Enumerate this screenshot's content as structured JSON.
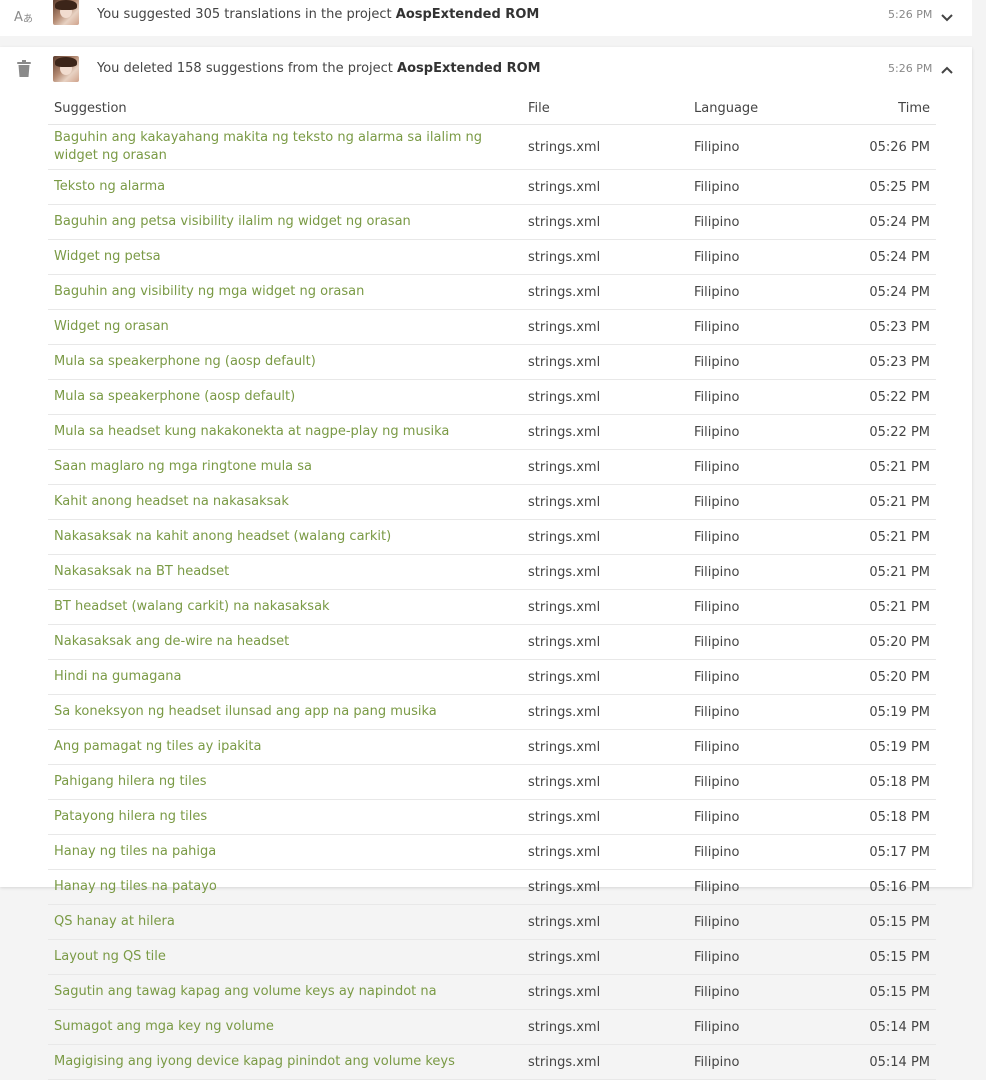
{
  "activities": [
    {
      "icon": "translate-icon",
      "text_prefix": "You suggested 305 translations in the project ",
      "project": "AospExtended ROM",
      "time": "5:26 PM"
    },
    {
      "icon": "trash-icon",
      "text_prefix": "You deleted 158 suggestions from the project ",
      "project": "AospExtended ROM",
      "time": "5:26 PM"
    }
  ],
  "table": {
    "headers": {
      "suggestion": "Suggestion",
      "file": "File",
      "language": "Language",
      "time": "Time"
    },
    "rows": [
      {
        "suggestion": "Baguhin ang kakayahang makita ng teksto ng alarma sa ilalim ng widget ng orasan",
        "file": "strings.xml",
        "language": "Filipino",
        "time": "05:26 PM"
      },
      {
        "suggestion": "Teksto ng alarma",
        "file": "strings.xml",
        "language": "Filipino",
        "time": "05:25 PM"
      },
      {
        "suggestion": "Baguhin ang petsa visibility ilalim ng widget ng orasan",
        "file": "strings.xml",
        "language": "Filipino",
        "time": "05:24 PM"
      },
      {
        "suggestion": "Widget ng petsa",
        "file": "strings.xml",
        "language": "Filipino",
        "time": "05:24 PM"
      },
      {
        "suggestion": "Baguhin ang visibility ng mga widget ng orasan",
        "file": "strings.xml",
        "language": "Filipino",
        "time": "05:24 PM"
      },
      {
        "suggestion": "Widget ng orasan",
        "file": "strings.xml",
        "language": "Filipino",
        "time": "05:23 PM"
      },
      {
        "suggestion": "Mula sa speakerphone ng (aosp default)",
        "file": "strings.xml",
        "language": "Filipino",
        "time": "05:23 PM"
      },
      {
        "suggestion": "Mula sa speakerphone (aosp default)",
        "file": "strings.xml",
        "language": "Filipino",
        "time": "05:22 PM"
      },
      {
        "suggestion": "Mula sa headset kung nakakonekta at nagpe-play ng musika",
        "file": "strings.xml",
        "language": "Filipino",
        "time": "05:22 PM"
      },
      {
        "suggestion": "Saan maglaro ng mga ringtone mula sa",
        "file": "strings.xml",
        "language": "Filipino",
        "time": "05:21 PM"
      },
      {
        "suggestion": "Kahit anong headset na nakasaksak",
        "file": "strings.xml",
        "language": "Filipino",
        "time": "05:21 PM"
      },
      {
        "suggestion": "Nakasaksak na kahit anong headset (walang carkit)",
        "file": "strings.xml",
        "language": "Filipino",
        "time": "05:21 PM"
      },
      {
        "suggestion": "Nakasaksak na BT headset",
        "file": "strings.xml",
        "language": "Filipino",
        "time": "05:21 PM"
      },
      {
        "suggestion": "BT headset (walang carkit) na nakasaksak",
        "file": "strings.xml",
        "language": "Filipino",
        "time": "05:21 PM"
      },
      {
        "suggestion": "Nakasaksak ang de-wire na headset",
        "file": "strings.xml",
        "language": "Filipino",
        "time": "05:20 PM"
      },
      {
        "suggestion": "Hindi na gumagana",
        "file": "strings.xml",
        "language": "Filipino",
        "time": "05:20 PM"
      },
      {
        "suggestion": "Sa koneksyon ng headset ilunsad ang app na pang musika",
        "file": "strings.xml",
        "language": "Filipino",
        "time": "05:19 PM"
      },
      {
        "suggestion": "Ang pamagat ng tiles ay ipakita",
        "file": "strings.xml",
        "language": "Filipino",
        "time": "05:19 PM"
      },
      {
        "suggestion": "Pahigang hilera ng tiles",
        "file": "strings.xml",
        "language": "Filipino",
        "time": "05:18 PM"
      },
      {
        "suggestion": "Patayong hilera ng tiles",
        "file": "strings.xml",
        "language": "Filipino",
        "time": "05:18 PM"
      },
      {
        "suggestion": "Hanay ng tiles na pahiga",
        "file": "strings.xml",
        "language": "Filipino",
        "time": "05:17 PM"
      },
      {
        "suggestion": "Hanay ng tiles na patayo",
        "file": "strings.xml",
        "language": "Filipino",
        "time": "05:16 PM"
      },
      {
        "suggestion": "QS hanay at hilera",
        "file": "strings.xml",
        "language": "Filipino",
        "time": "05:15 PM"
      },
      {
        "suggestion": "Layout ng QS tile",
        "file": "strings.xml",
        "language": "Filipino",
        "time": "05:15 PM"
      },
      {
        "suggestion": "Sagutin ang tawag kapag ang volume keys ay napindot na",
        "file": "strings.xml",
        "language": "Filipino",
        "time": "05:15 PM"
      },
      {
        "suggestion": "Sumagot ang mga key ng volume",
        "file": "strings.xml",
        "language": "Filipino",
        "time": "05:14 PM"
      },
      {
        "suggestion": "Magigising ang iyong device kapag pinindot ang volume keys",
        "file": "strings.xml",
        "language": "Filipino",
        "time": "05:14 PM"
      }
    ]
  },
  "colors": {
    "suggestion_link": "#7a9a45",
    "background": "#f4f4f4",
    "card": "#ffffff"
  }
}
